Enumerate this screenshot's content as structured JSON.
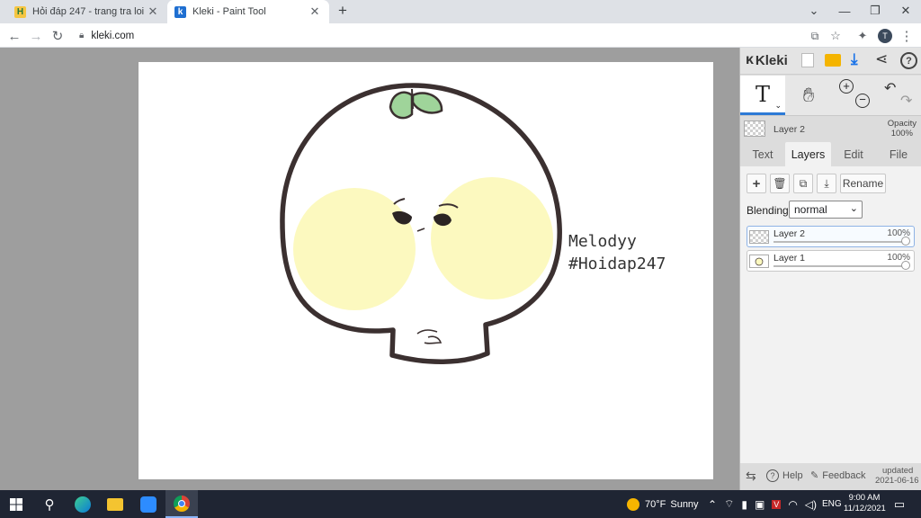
{
  "browser": {
    "tabs": [
      {
        "title": "Hỏi đáp 247 - trang tra loi",
        "favicon": "H",
        "active": false
      },
      {
        "title": "Kleki - Paint Tool",
        "favicon": "k",
        "active": true
      }
    ],
    "new_tab_icon": "plus-icon",
    "url": "kleki.com",
    "profile_initial": "T"
  },
  "canvas": {
    "text_line1": "Melodyy",
    "text_line2": "#Hoidap247"
  },
  "kleki": {
    "logo_text": "Kleki",
    "tool_text_glyph": "T",
    "layer_info": {
      "name": "Layer 2",
      "opacity_label": "Opacity",
      "opacity_value": "100%"
    },
    "tabs": [
      {
        "label": "Text",
        "active": false
      },
      {
        "label": "Layers",
        "active": true
      },
      {
        "label": "Edit",
        "active": false
      },
      {
        "label": "File",
        "active": false
      }
    ],
    "rename_label": "Rename",
    "blending_label": "Blending",
    "blending_value": "normal",
    "layers": [
      {
        "name": "Layer 2",
        "opacity": "100%",
        "selected": true
      },
      {
        "name": "Layer 1",
        "opacity": "100%",
        "selected": false
      }
    ],
    "footer": {
      "help": "Help",
      "feedback": "Feedback",
      "updated_label": "updated",
      "updated_date": "2021-06-16"
    }
  },
  "taskbar": {
    "weather_temp": "70°F",
    "weather_text": "Sunny",
    "lang": "ENG",
    "time": "9:00 AM",
    "date": "11/12/2021"
  },
  "colors": {
    "head_fill": "#ffffff",
    "outline": "#3b3030",
    "cheek": "#fcf9bf",
    "leaf": "#9fd49a"
  }
}
